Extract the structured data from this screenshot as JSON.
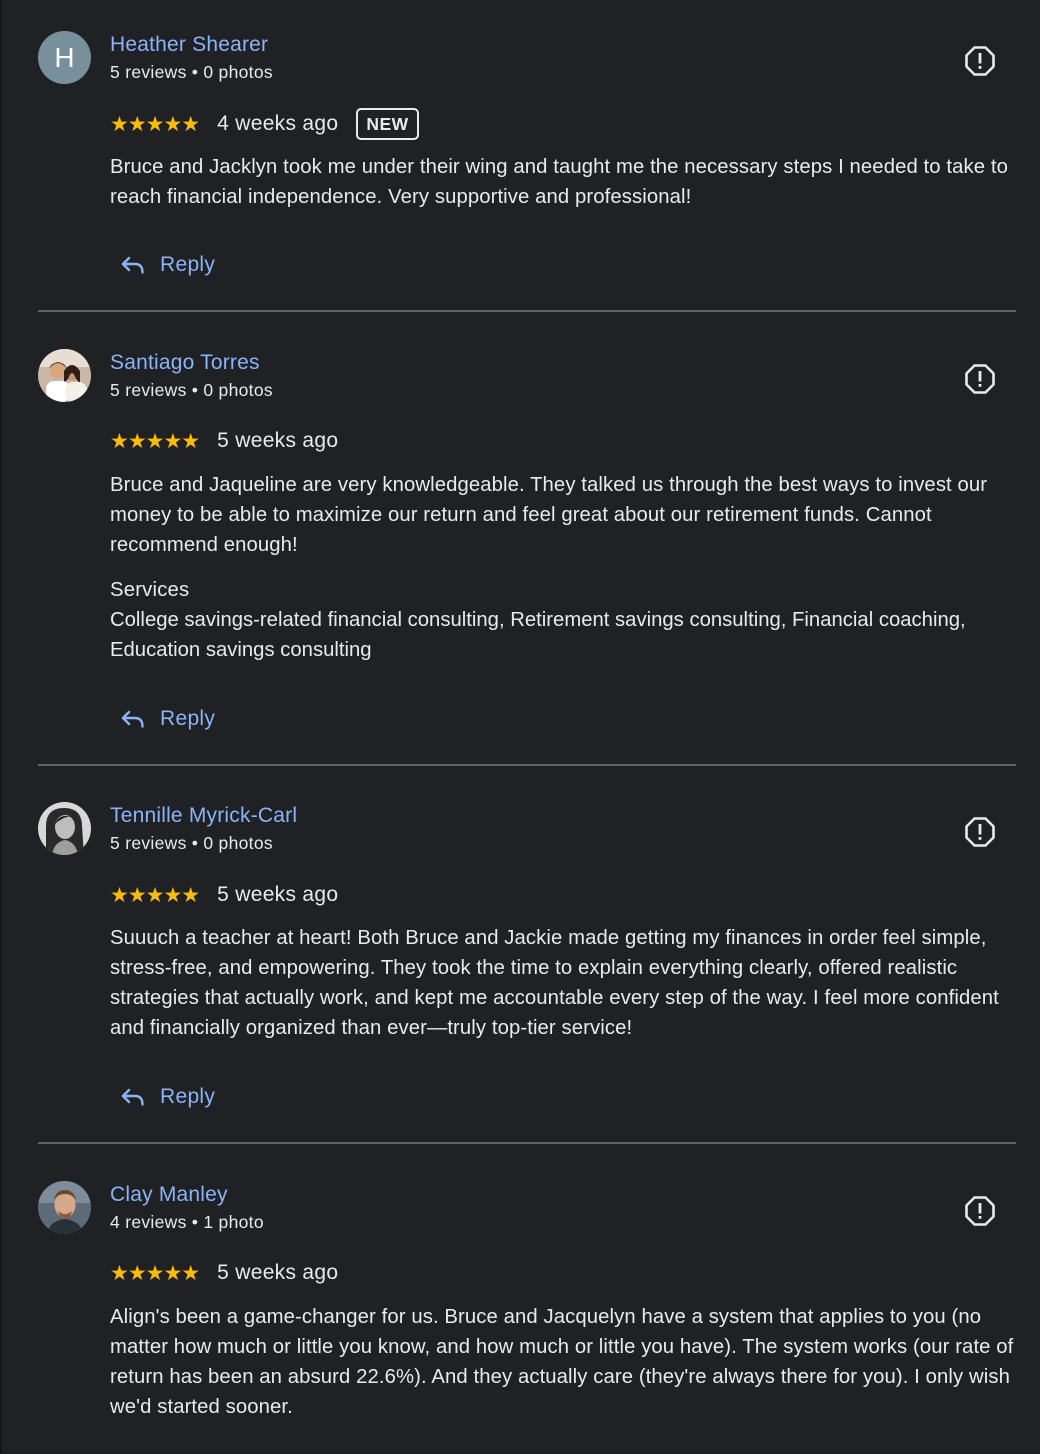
{
  "colors": {
    "background": "#202124",
    "link": "#8ab4f8",
    "text": "#e8eaed",
    "star": "#fbbc04",
    "divider": "#5f6368"
  },
  "reviews": [
    {
      "name": "Heather Shearer",
      "avatar_letter": "H",
      "meta": "5 reviews • 0 photos",
      "stars": "★★★★★",
      "rating": 5,
      "date": "4 weeks ago",
      "badge": "NEW",
      "text": "Bruce and Jacklyn took me under their wing and taught me the necessary steps I needed to take to reach financial independence. Very supportive and professional!",
      "reply_label": "Reply"
    },
    {
      "name": "Santiago Torres",
      "meta": "5 reviews • 0 photos",
      "stars": "★★★★★",
      "rating": 5,
      "date": "5 weeks ago",
      "text": "Bruce and Jaqueline are very knowledgeable. They talked us through the best ways to invest our money to be able to maximize our return and feel great about our retirement funds. Cannot recommend enough!",
      "services_label": "Services",
      "services": "College savings-related financial consulting, Retirement savings consulting, Financial coaching, Education savings consulting",
      "reply_label": "Reply"
    },
    {
      "name": "Tennille Myrick-Carl",
      "meta": "5 reviews • 0 photos",
      "stars": "★★★★★",
      "rating": 5,
      "date": "5 weeks ago",
      "text": "Suuuch a teacher at heart! Both Bruce and Jackie made getting my finances in order feel simple, stress-free, and empowering. They took the time to explain everything clearly, offered realistic strategies that actually work, and kept me accountable every step of the way. I feel more confident and financially organized than ever—truly top-tier service!",
      "reply_label": "Reply"
    },
    {
      "name": "Clay Manley",
      "meta": "4 reviews • 1 photo",
      "stars": "★★★★★",
      "rating": 5,
      "date": "5 weeks ago",
      "text": "Align's been a game-changer for us. Bruce and Jacquelyn have a system that applies to you (no matter how much or little you know, and how much or little you have). The system works (our rate of return has been an absurd 22.6%). And they actually care (they're always there for you). I only wish we'd started sooner."
    }
  ]
}
